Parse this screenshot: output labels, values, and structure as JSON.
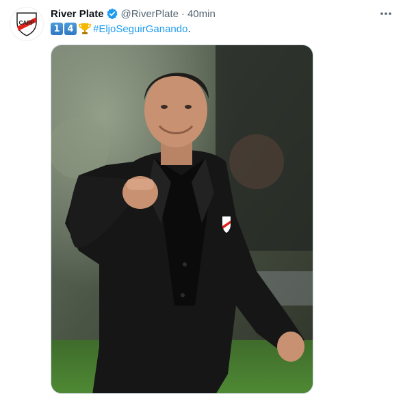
{
  "tweet": {
    "author": {
      "display_name": "River Plate",
      "handle": "@RiverPlate",
      "verified": true,
      "avatar_icon": "river-plate-crest-icon"
    },
    "separator": "·",
    "time": "40min",
    "text": {
      "keycaps": [
        "1",
        "4"
      ],
      "emoji_icon": "trophy-icon",
      "hashtag": "#EljoSeguirGanando",
      "trailing": "."
    },
    "media": {
      "icon": "photo-man-black-suit-fist-pump"
    }
  },
  "colors": {
    "accent": "#1d9bf0",
    "secondary_text": "#536471",
    "club_red": "#e2231a"
  }
}
